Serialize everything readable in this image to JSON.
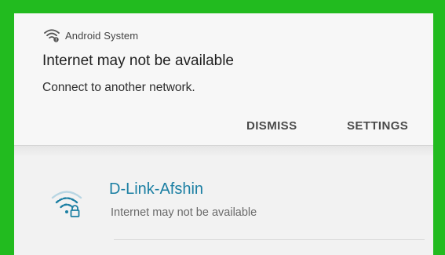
{
  "notification": {
    "app_name": "Android System",
    "app_icon": "wifi-alert-icon",
    "title": "Internet may not be available",
    "body": "Connect to another network.",
    "actions": {
      "dismiss": "DISMISS",
      "settings": "SETTINGS"
    }
  },
  "wifi_list": {
    "items": [
      {
        "ssid": "D-Link-Afshin",
        "status": "Internet may not be available",
        "icon": "wifi-locked-icon",
        "secured": true
      }
    ]
  },
  "colors": {
    "background_border": "#22bb1f",
    "ssid": "#1b7fa3",
    "wifi_icon": "#1b7fa3"
  }
}
